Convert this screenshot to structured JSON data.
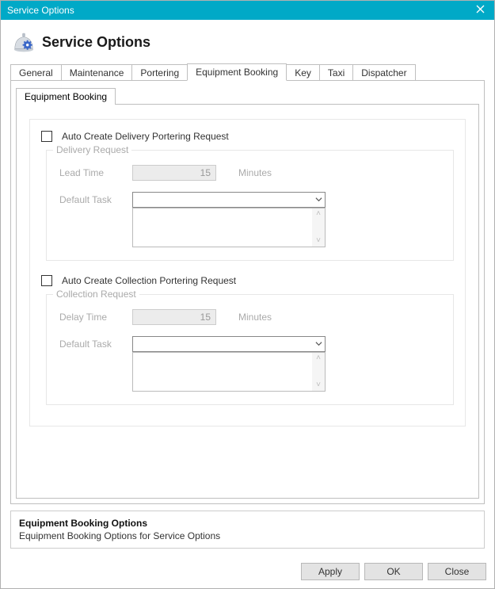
{
  "window": {
    "title": "Service Options"
  },
  "header": {
    "title": "Service Options"
  },
  "outer_tabs": {
    "items": [
      {
        "label": "General"
      },
      {
        "label": "Maintenance"
      },
      {
        "label": "Portering"
      },
      {
        "label": "Equipment Booking"
      },
      {
        "label": "Key"
      },
      {
        "label": "Taxi"
      },
      {
        "label": "Dispatcher"
      }
    ]
  },
  "inner_tabs": {
    "items": [
      {
        "label": "Equipment Booking"
      }
    ]
  },
  "delivery": {
    "checkbox_label": "Auto Create Delivery Portering Request",
    "checked": false,
    "group_legend": "Delivery Request",
    "lead_time_label": "Lead Time",
    "lead_time_value": "15",
    "lead_time_unit": "Minutes",
    "default_task_label": "Default Task",
    "default_task_value": ""
  },
  "collection": {
    "checkbox_label": "Auto Create Collection Portering Request",
    "checked": false,
    "group_legend": "Collection Request",
    "delay_time_label": "Delay Time",
    "delay_time_value": "15",
    "delay_time_unit": "Minutes",
    "default_task_label": "Default Task",
    "default_task_value": ""
  },
  "description": {
    "title": "Equipment Booking Options",
    "text": "Equipment Booking Options for Service Options"
  },
  "footer": {
    "apply": "Apply",
    "ok": "OK",
    "close": "Close"
  }
}
